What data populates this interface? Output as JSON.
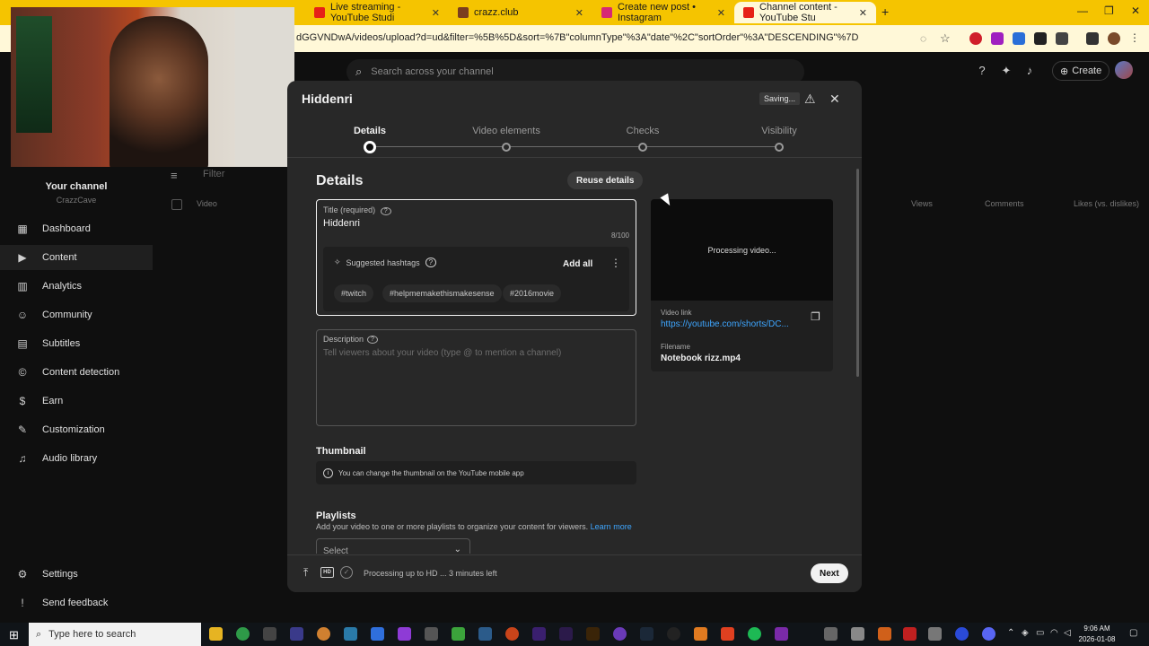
{
  "browser": {
    "tabs": [
      {
        "label": "Live streaming - YouTube Studi",
        "color": "#e62117"
      },
      {
        "label": "crazz.club",
        "color": "#7a3e1f"
      },
      {
        "label": "Create new post • Instagram",
        "color": "#d62976"
      },
      {
        "label": "Channel content - YouTube Stu",
        "color": "#e62117"
      }
    ],
    "url": "dGGVNDwA/videos/upload?d=ud&filter=%5B%5D&sort=%7B\"columnType\"%3A\"date\"%2C\"sortOrder\"%3A\"DESCENDING\"%7D"
  },
  "header": {
    "search_placeholder": "Search across your channel",
    "create_label": "Create"
  },
  "sidebar": {
    "channel_title": "Your channel",
    "channel_handle": "CrazzCave",
    "items": [
      {
        "label": "Dashboard",
        "icon": "dashboard-icon",
        "glyph": "▦"
      },
      {
        "label": "Content",
        "icon": "content-icon",
        "glyph": "▶"
      },
      {
        "label": "Analytics",
        "icon": "analytics-icon",
        "glyph": "▥"
      },
      {
        "label": "Community",
        "icon": "community-icon",
        "glyph": "☺"
      },
      {
        "label": "Subtitles",
        "icon": "subtitles-icon",
        "glyph": "▤"
      },
      {
        "label": "Content detection",
        "icon": "copyright-icon",
        "glyph": "©"
      },
      {
        "label": "Earn",
        "icon": "earn-icon",
        "glyph": "$"
      },
      {
        "label": "Customization",
        "icon": "customization-icon",
        "glyph": "✎"
      },
      {
        "label": "Audio library",
        "icon": "audio-library-icon",
        "glyph": "♫"
      }
    ],
    "settings_label": "Settings",
    "feedback_label": "Send feedback"
  },
  "content_list": {
    "filter_label": "Filter",
    "columns": {
      "video": "Video",
      "views": "Views",
      "comments": "Comments",
      "likes": "Likes (vs. dislikes)"
    }
  },
  "modal": {
    "title": "Hiddenri",
    "saving_label": "Saving...",
    "steps": [
      {
        "label": "Details"
      },
      {
        "label": "Video elements"
      },
      {
        "label": "Checks"
      },
      {
        "label": "Visibility"
      }
    ],
    "section_title": "Details",
    "reuse_label": "Reuse details",
    "title_field": {
      "label": "Title (required)",
      "value": "Hiddenri",
      "count": "8/100"
    },
    "hashtags": {
      "label": "Suggested hashtags",
      "add_all_label": "Add all",
      "tags": [
        "#twitch",
        "#helpmemakethismakesense",
        "#2016movie"
      ]
    },
    "description_field": {
      "label": "Description",
      "placeholder": "Tell viewers about your video (type @ to mention a channel)"
    },
    "thumbnail": {
      "heading": "Thumbnail",
      "note": "You can change the thumbnail on the YouTube mobile app"
    },
    "playlists": {
      "heading": "Playlists",
      "note": "Add your video to one or more playlists to organize your content for viewers.",
      "learn_more": "Learn more",
      "select_label": "Select"
    },
    "preview": {
      "processing_text": "Processing video...",
      "video_link_label": "Video link",
      "video_link": "https://youtube.com/shorts/DC...",
      "filename_label": "Filename",
      "filename": "Notebook rizz.mp4"
    },
    "footer": {
      "status": "Processing up to HD ... 3 minutes left",
      "next_label": "Next"
    }
  },
  "taskbar": {
    "search_placeholder": "Type here to search",
    "time": "9:06 AM",
    "date": "2026-01-08"
  }
}
